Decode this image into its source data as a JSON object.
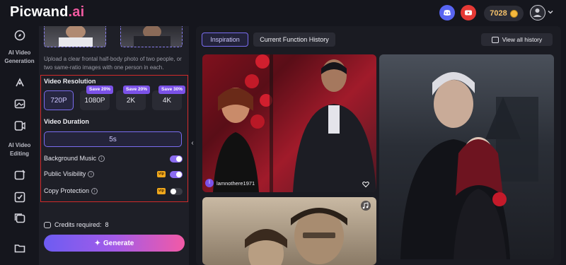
{
  "app": {
    "logo_main": "Picwand",
    "logo_suffix": ".ai"
  },
  "header": {
    "credit_balance": "7028",
    "icons": [
      "discord-icon",
      "youtube-icon",
      "coin-icon",
      "user-avatar-icon",
      "chevron-down-icon"
    ]
  },
  "leftnav": {
    "group1_label": "AI Video Generation",
    "group2_label": "AI Video Editing"
  },
  "panel": {
    "upload_hint": "Upload a clear frontal half-body photo of two people, or two same-ratio images with one person in each.",
    "resolution_title": "Video Resolution",
    "resolutions": [
      {
        "label": "720P",
        "badge": ""
      },
      {
        "label": "1080P",
        "badge": "Save 20%"
      },
      {
        "label": "2K",
        "badge": "Save 20%"
      },
      {
        "label": "4K",
        "badge": "Save 30%"
      }
    ],
    "duration_title": "Video Duration",
    "duration_value": "5s",
    "toggles": [
      {
        "label": "Background Music",
        "vip": "",
        "on": true
      },
      {
        "label": "Public Visibility",
        "vip": "vip",
        "on": true
      },
      {
        "label": "Copy Protection",
        "vip": "vip",
        "on": false
      }
    ],
    "credits_label": "Credits required:",
    "credits_value": "8",
    "generate_label": "Generate"
  },
  "content": {
    "tab_active": "Inspiration",
    "tab_inactive": "Current Function History",
    "view_history": "View all history",
    "card1_user": "lamnothere1971",
    "card1_user_initial": "l"
  },
  "colors": {
    "accent": "#7a6cf0",
    "highlight_border": "#d02a2a",
    "vip": "#f0a81c",
    "save_badge": "#7b52e8"
  }
}
